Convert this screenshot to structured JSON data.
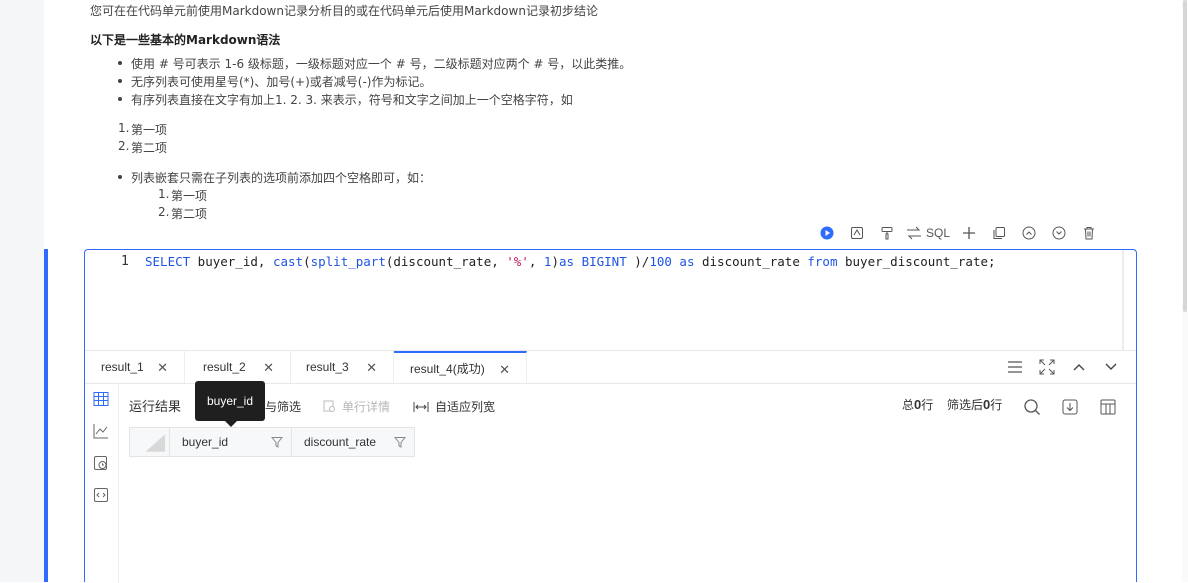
{
  "markdown": {
    "intro": "您可在在代码单元前使用Markdown记录分析目的或在代码单元后使用Markdown记录初步结论",
    "heading": "以下是一些基本的Markdown语法",
    "bullets": [
      "使用 # 号可表示 1-6 级标题，一级标题对应一个 # 号，二级标题对应两个 # 号，以此类推。",
      "无序列表可使用星号(*)、加号(+)或者减号(-)作为标记。",
      "有序列表直接在文字有加上1. 2. 3. 来表示，符号和文字之间加上一个空格字符，如"
    ],
    "ordered": [
      "第一项",
      "第二项"
    ],
    "ordered_nums": [
      "1.",
      "2."
    ],
    "nested_bullet": "列表嵌套只需在子列表的选项前添加四个空格即可，如：",
    "nested_items": [
      "第一项",
      "第二项"
    ]
  },
  "toolbar": {
    "sql_label": "SQL",
    "icons": [
      "run-icon",
      "format-icon",
      "paint-icon",
      "swap-icon",
      "add-icon",
      "copy-icon",
      "move-up-icon",
      "move-down-icon",
      "delete-icon"
    ]
  },
  "editor": {
    "line_number": "1",
    "tokens": [
      {
        "t": "SELECT",
        "c": "kw"
      },
      {
        "t": " buyer_id, ",
        "c": ""
      },
      {
        "t": "cast",
        "c": "kw"
      },
      {
        "t": "(",
        "c": ""
      },
      {
        "t": "split_part",
        "c": "kw"
      },
      {
        "t": "(discount_rate, ",
        "c": ""
      },
      {
        "t": "'%'",
        "c": "str"
      },
      {
        "t": ", ",
        "c": ""
      },
      {
        "t": "1",
        "c": "kw"
      },
      {
        "t": ")",
        "c": ""
      },
      {
        "t": "as",
        "c": "kw"
      },
      {
        "t": " ",
        "c": ""
      },
      {
        "t": "BIGINT",
        "c": "kw"
      },
      {
        "t": " )/",
        "c": ""
      },
      {
        "t": "100",
        "c": "kw"
      },
      {
        "t": " ",
        "c": ""
      },
      {
        "t": "as",
        "c": "kw"
      },
      {
        "t": " discount_rate ",
        "c": ""
      },
      {
        "t": "from",
        "c": "kw"
      },
      {
        "t": " buyer_discount_rate;",
        "c": ""
      }
    ]
  },
  "results": {
    "tabs": [
      {
        "label": "result_1",
        "active": false
      },
      {
        "label": "result_2",
        "active": false
      },
      {
        "label": "result_3",
        "active": false
      },
      {
        "label": "result_4(成功)",
        "active": true
      }
    ],
    "title": "运行结果",
    "filter_label": "与筛选",
    "row_detail_label": "单行详情",
    "autofit_label": "自适应列宽",
    "total_prefix": "总",
    "total_count": "0",
    "total_suffix": "行",
    "filtered_prefix": "筛选后",
    "filtered_count": "0",
    "filtered_suffix": "行",
    "columns": [
      "buyer_id",
      "discount_rate"
    ],
    "tooltip": "buyer_id"
  },
  "colors": {
    "accent": "#2f6bff",
    "keyword": "#1f54e6",
    "string": "#c2185b"
  }
}
